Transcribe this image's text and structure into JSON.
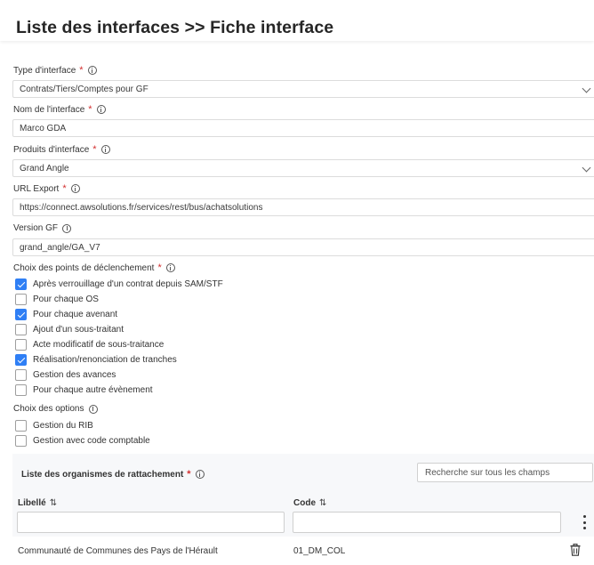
{
  "header": {
    "title": "Liste des interfaces >> Fiche interface"
  },
  "form": {
    "type_interface": {
      "label": "Type d'interface",
      "value": "Contrats/Tiers/Comptes pour GF"
    },
    "nom_interface": {
      "label": "Nom de l'interface",
      "value": "Marco GDA"
    },
    "produits_interface": {
      "label": "Produits d'interface",
      "value": "Grand Angle"
    },
    "url_export": {
      "label": "URL Export",
      "value": "https://connect.awsolutions.fr/services/rest/bus/achatsolutions"
    },
    "version_gf": {
      "label": "Version GF",
      "value": "grand_angle/GA_V7"
    },
    "required_marker": "*"
  },
  "declenchement": {
    "label": "Choix des points de déclenchement",
    "items": [
      {
        "label": "Après verrouillage d'un contrat depuis SAM/STF",
        "checked": true
      },
      {
        "label": "Pour chaque OS",
        "checked": false
      },
      {
        "label": "Pour chaque avenant",
        "checked": true
      },
      {
        "label": "Ajout d'un sous-traitant",
        "checked": false
      },
      {
        "label": "Acte modificatif de sous-traitance",
        "checked": false
      },
      {
        "label": "Réalisation/renonciation de tranches",
        "checked": true
      },
      {
        "label": "Gestion des avances",
        "checked": false
      },
      {
        "label": "Pour chaque autre évènement",
        "checked": false
      }
    ]
  },
  "options": {
    "label": "Choix des options",
    "items": [
      {
        "label": "Gestion du RIB",
        "checked": false
      },
      {
        "label": "Gestion avec code comptable",
        "checked": false
      }
    ]
  },
  "organismes": {
    "title": "Liste des organismes de rattachement",
    "search_placeholder": "Recherche sur tous les champs",
    "columns": {
      "libelle": "Libellé",
      "code": "Code",
      "sort_glyph": "⇅"
    },
    "rows": [
      {
        "libelle": "Communauté de Communes des Pays de l'Hérault",
        "code": "01_DM_COL"
      }
    ]
  },
  "colors": {
    "accent": "#2f7ff5",
    "required": "#d32f2f"
  }
}
